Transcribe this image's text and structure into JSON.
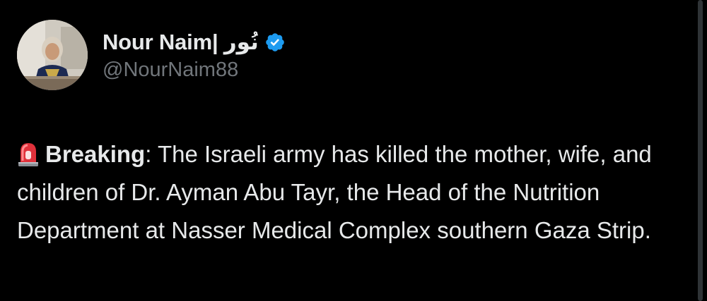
{
  "tweet": {
    "author": {
      "display_name": "Nour Naim| نُور",
      "handle": "@NourNaim88",
      "avatar_icon": "profile-photo",
      "verified_icon": "verified-badge-icon",
      "verified_color": "#1d9bf0"
    },
    "body": {
      "emoji_icon": "police-siren-icon",
      "lead": "Breaking",
      "text": ": The Israeli army has killed the mother, wife, and children of Dr. Ayman Abu Tayr, the Head of the Nutrition Department at Nasser Medical Complex southern Gaza Strip."
    }
  },
  "theme": {
    "background": "#000000",
    "text": "#e7e9ea",
    "secondary_text": "#71767b"
  }
}
